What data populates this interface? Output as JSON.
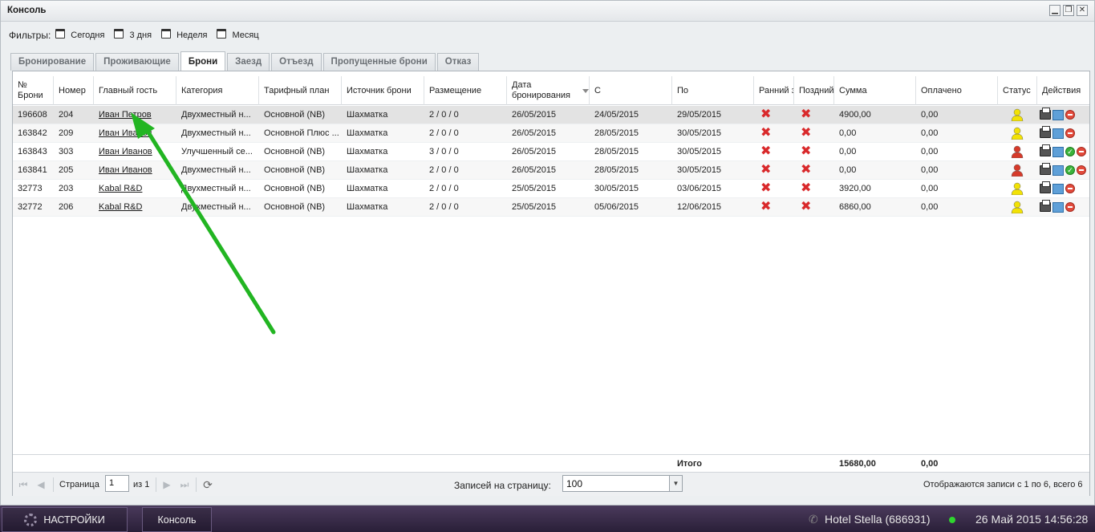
{
  "window": {
    "title": "Консоль",
    "btn_minimize": "▁",
    "btn_restore": "❐",
    "btn_close": "✕"
  },
  "filters": {
    "label": "Фильтры:",
    "items": [
      "Сегодня",
      "3 дня",
      "Неделя",
      "Месяц"
    ]
  },
  "tabs": [
    "Бронирование",
    "Проживающие",
    "Брони",
    "Заезд",
    "Отъезд",
    "Пропущенные брони",
    "Отказ"
  ],
  "active_tab": "Брони",
  "columns": {
    "num": "№ Брони",
    "room": "Номер",
    "guest": "Главный гость",
    "category": "Категория",
    "rate": "Тарифный план",
    "source": "Источник брони",
    "placement": "Размещение",
    "booked": "Дата бронирования",
    "from": "С",
    "to": "По",
    "early": "Ранний з",
    "late": "Поздний",
    "sum": "Сумма",
    "paid": "Оплачено",
    "status": "Статус",
    "actions": "Действия"
  },
  "rows": [
    {
      "num": "196608",
      "room": "204",
      "guest": "Иван Петров",
      "category": "Двухместный н...",
      "rate": "Основной (NB)",
      "source": "Шахматка",
      "placement": "2 / 0 / 0",
      "booked": "26/05/2015",
      "from": "24/05/2015",
      "to": "29/05/2015",
      "sum": "4900,00",
      "paid": "0,00",
      "status_color": "#f2e205",
      "checkin_ok": false
    },
    {
      "num": "163842",
      "room": "209",
      "guest": "Иван Иванов",
      "category": "Двухместный н...",
      "rate": "Основной Плюс ...",
      "source": "Шахматка",
      "placement": "2 / 0 / 0",
      "booked": "26/05/2015",
      "from": "28/05/2015",
      "to": "30/05/2015",
      "sum": "0,00",
      "paid": "0,00",
      "status_color": "#f2e205",
      "checkin_ok": false
    },
    {
      "num": "163843",
      "room": "303",
      "guest": "Иван Иванов",
      "category": "Улучшенный се...",
      "rate": "Основной (NB)",
      "source": "Шахматка",
      "placement": "3 / 0 / 0",
      "booked": "26/05/2015",
      "from": "28/05/2015",
      "to": "30/05/2015",
      "sum": "0,00",
      "paid": "0,00",
      "status_color": "#d63a2a",
      "checkin_ok": true
    },
    {
      "num": "163841",
      "room": "205",
      "guest": "Иван Иванов",
      "category": "Двухместный н...",
      "rate": "Основной (NB)",
      "source": "Шахматка",
      "placement": "2 / 0 / 0",
      "booked": "26/05/2015",
      "from": "28/05/2015",
      "to": "30/05/2015",
      "sum": "0,00",
      "paid": "0,00",
      "status_color": "#d63a2a",
      "checkin_ok": true
    },
    {
      "num": "32773",
      "room": "203",
      "guest": "Kabal R&D",
      "category": "Двухместный н...",
      "rate": "Основной (NB)",
      "source": "Шахматка",
      "placement": "2 / 0 / 0",
      "booked": "25/05/2015",
      "from": "30/05/2015",
      "to": "03/06/2015",
      "sum": "3920,00",
      "paid": "0,00",
      "status_color": "#f2e205",
      "checkin_ok": false
    },
    {
      "num": "32772",
      "room": "206",
      "guest": "Kabal R&D",
      "category": "Двухместный н...",
      "rate": "Основной (NB)",
      "source": "Шахматка",
      "placement": "2 / 0 / 0",
      "booked": "25/05/2015",
      "from": "05/06/2015",
      "to": "12/06/2015",
      "sum": "6860,00",
      "paid": "0,00",
      "status_color": "#f2e205",
      "checkin_ok": false
    }
  ],
  "totals": {
    "label": "Итого",
    "sum": "15680,00",
    "paid": "0,00"
  },
  "paging": {
    "page_label": "Страница",
    "page_value": "1",
    "of_label": "из 1",
    "per_page_label": "Записей на страницу:",
    "per_page_value": "100",
    "summary": "Отображаются записи с 1 по 6, всего 6"
  },
  "taskbar": {
    "settings": "НАСТРОЙКИ",
    "console": "Консоль",
    "hotel": "Hotel Stella (686931)",
    "datetime": "26 Май 2015 14:56:28"
  },
  "colors": {
    "arrow": "#22b522",
    "status_yellow": "#f2e205",
    "status_red": "#d63a2a"
  }
}
